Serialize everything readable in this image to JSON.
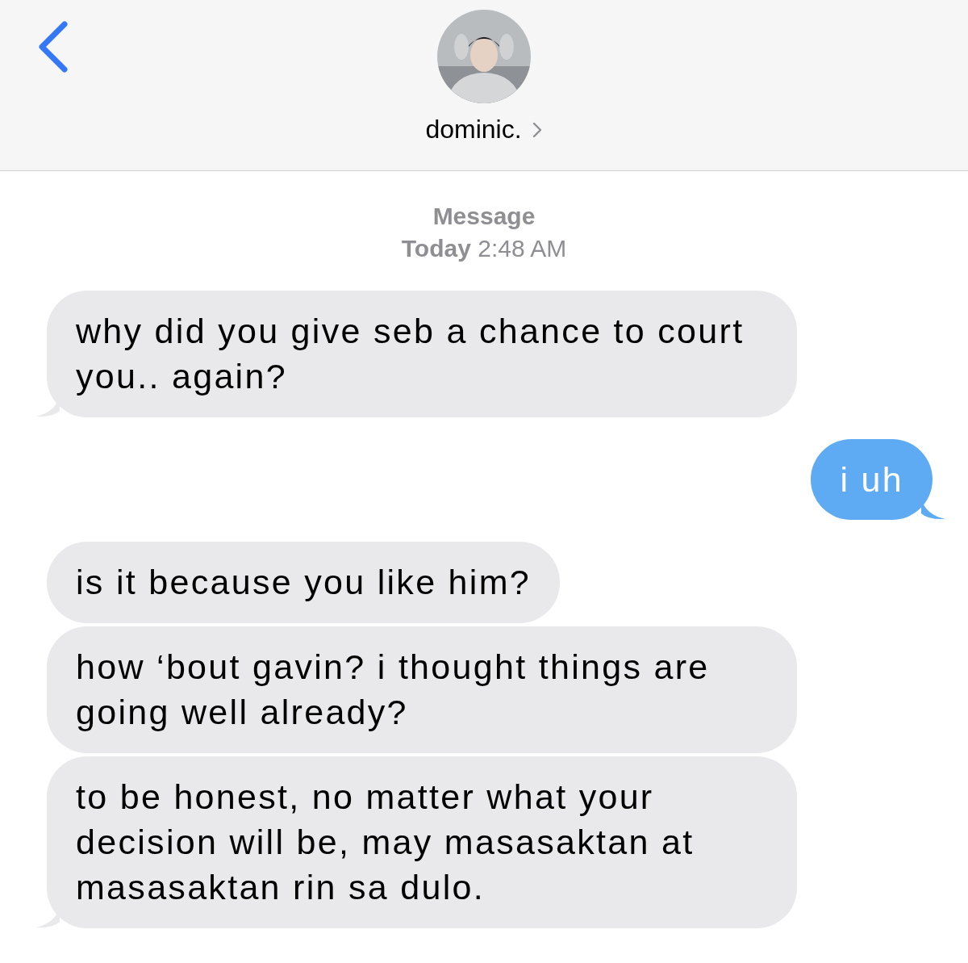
{
  "header": {
    "contact": {
      "name": "dominic."
    }
  },
  "timestamp": {
    "service": "Message",
    "time": "**Today** 2:48 AM"
  },
  "messages": [
    {
      "kind": "received",
      "text": "why did you give seb a chance to court you.. again?",
      "tail": true
    },
    {
      "kind": "sent",
      "text": "i uh",
      "tail": true
    },
    {
      "kind": "received",
      "text": "is it because you like him?",
      "tail": false
    },
    {
      "kind": "received",
      "text": "how ‘bout gavin? i thought things are going well already?",
      "tail": false
    },
    {
      "kind": "received",
      "text": "to be honest, no matter what your decision will be, may masasaktan at masasaktan rin sa dulo.",
      "tail": true
    }
  ]
}
